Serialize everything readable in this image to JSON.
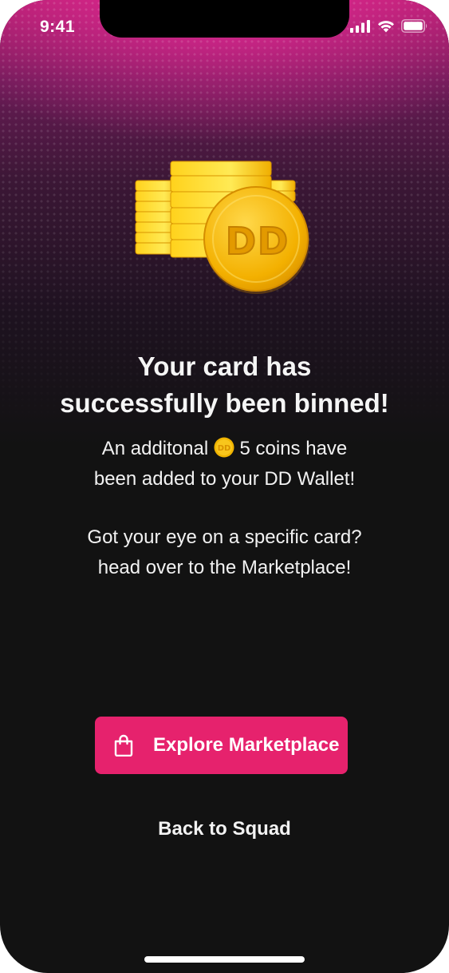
{
  "status_bar": {
    "time": "9:41",
    "icons": [
      "cellular-signal-icon",
      "wifi-icon",
      "battery-icon"
    ]
  },
  "hero": {
    "icon": "coin-stack-icon",
    "coin_text": "DD"
  },
  "headline": {
    "line1": "Your card has",
    "line2": "successfully been binned!"
  },
  "coins_message": {
    "prefix": "An additonal",
    "coin_icon": "dd-coin-icon",
    "suffix": "5 coins have",
    "line2": "been added to your DD Wallet!"
  },
  "marketplace_message": {
    "line1": "Got your eye on a specific card?",
    "line2": "head over to the Marketplace!"
  },
  "primary_button": {
    "icon": "shopping-bag-icon",
    "label": "Explore Marketplace"
  },
  "secondary_link": {
    "label": "Back to Squad"
  },
  "colors": {
    "accent": "#e6226d",
    "background": "#121212",
    "gradient_top": "#b0206e",
    "coin_gold": "#f6c000"
  }
}
